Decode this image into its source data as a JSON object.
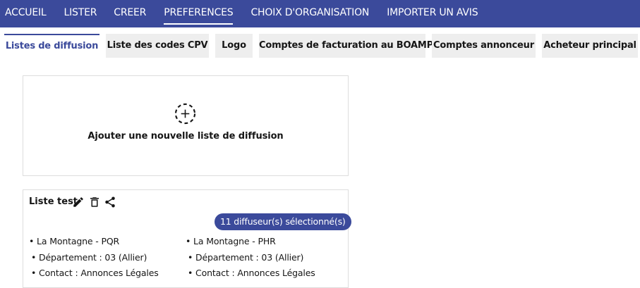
{
  "topnav": {
    "items": [
      "ACCUEIL",
      "LISTER",
      "CREER",
      "PREFERENCES",
      "CHOIX D'ORGANISATION",
      "IMPORTER UN AVIS"
    ],
    "active": "PREFERENCES"
  },
  "tabs": {
    "items": [
      "Listes de diffusion",
      "Liste des codes CPV",
      "Logo",
      "Comptes de facturation au BOAMP",
      "Comptes annonceur",
      "Acheteur principal"
    ],
    "active": "Listes de diffusion"
  },
  "add_card": {
    "label": "Ajouter une nouvelle liste de diffusion",
    "icon": "add-circle-dashed-icon"
  },
  "list_card": {
    "title": "Liste test",
    "badge": "11 diffuseur(s) sélectionné(s)",
    "icons": [
      "edit-pencil-icon",
      "trash-icon",
      "share-icon"
    ],
    "columns": [
      {
        "name": "• La Montagne - PQR",
        "department": "• Département : 03 (Allier)",
        "contact": "• Contact : Annonces Légales"
      },
      {
        "name": "• La Montagne - PHR",
        "department": "• Département : 03 (Allier)",
        "contact": "• Contact : Annonces Légales"
      }
    ]
  },
  "colors": {
    "primary": "#3b4a9b",
    "tab_bg": "#eeeeee",
    "border": "#dddddd"
  }
}
